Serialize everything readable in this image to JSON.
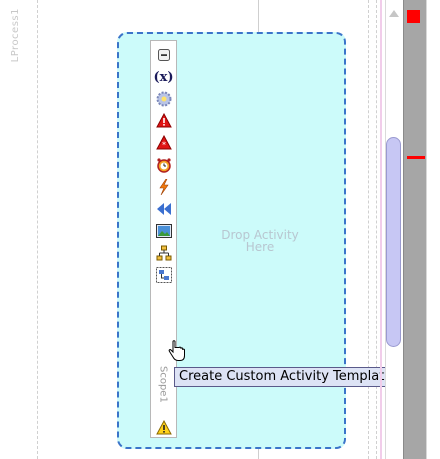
{
  "process_lane": {
    "label": "LProcess1"
  },
  "scope": {
    "name": "Scope1",
    "drop_hint_line1": "Drop Activity",
    "drop_hint_line2": "Here"
  },
  "toolbar": {
    "items": [
      {
        "icon": "collapse-icon"
      },
      {
        "icon": "variables-icon",
        "text": "(x)"
      },
      {
        "icon": "gear-icon"
      },
      {
        "icon": "fault-handler-icon"
      },
      {
        "icon": "catch-all-icon"
      },
      {
        "icon": "alarm-icon"
      },
      {
        "icon": "event-icon"
      },
      {
        "icon": "compensation-icon"
      },
      {
        "icon": "image-icon"
      },
      {
        "icon": "hierarchy-icon"
      },
      {
        "icon": "create-template-icon"
      },
      {
        "icon": "warning-icon"
      }
    ]
  },
  "tooltip": {
    "text": "Create Custom Activity Template"
  },
  "colors": {
    "scope_fill": "#ccfbfa",
    "scope_border": "#3b74c9",
    "error_marker": "#ff0000",
    "scroll_thumb": "#c7c7f4"
  }
}
